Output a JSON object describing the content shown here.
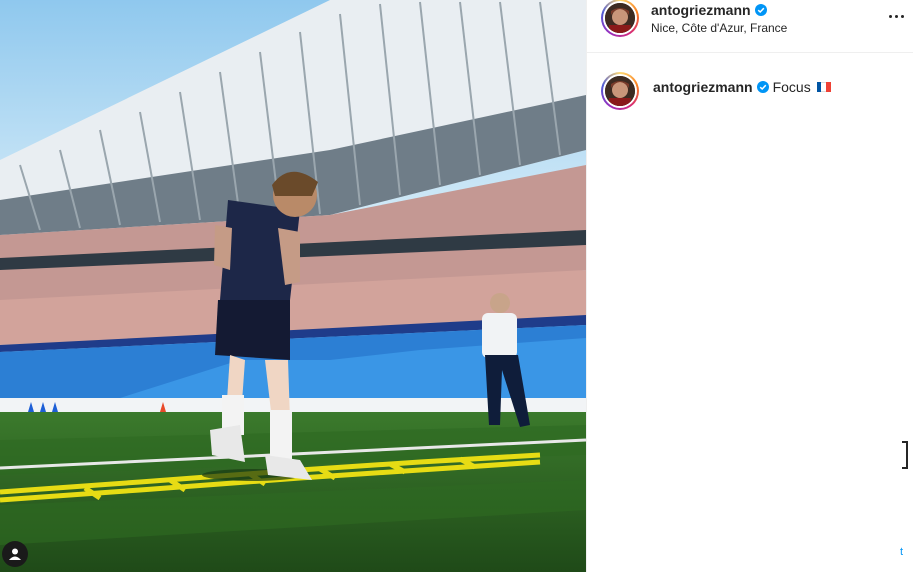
{
  "post": {
    "username": "antogriezmann",
    "location": "Nice, Côte d'Azur, France",
    "caption_username": "antogriezmann",
    "caption_text": "Focus",
    "flag_colors": [
      "#0055A4",
      "#FFFFFF",
      "#EF4135"
    ],
    "verified_color": "#0095f6",
    "partial_link": "t"
  },
  "icons": {
    "more": "more-options-icon",
    "verified": "verified-badge-icon",
    "tag": "user-tag-icon"
  }
}
